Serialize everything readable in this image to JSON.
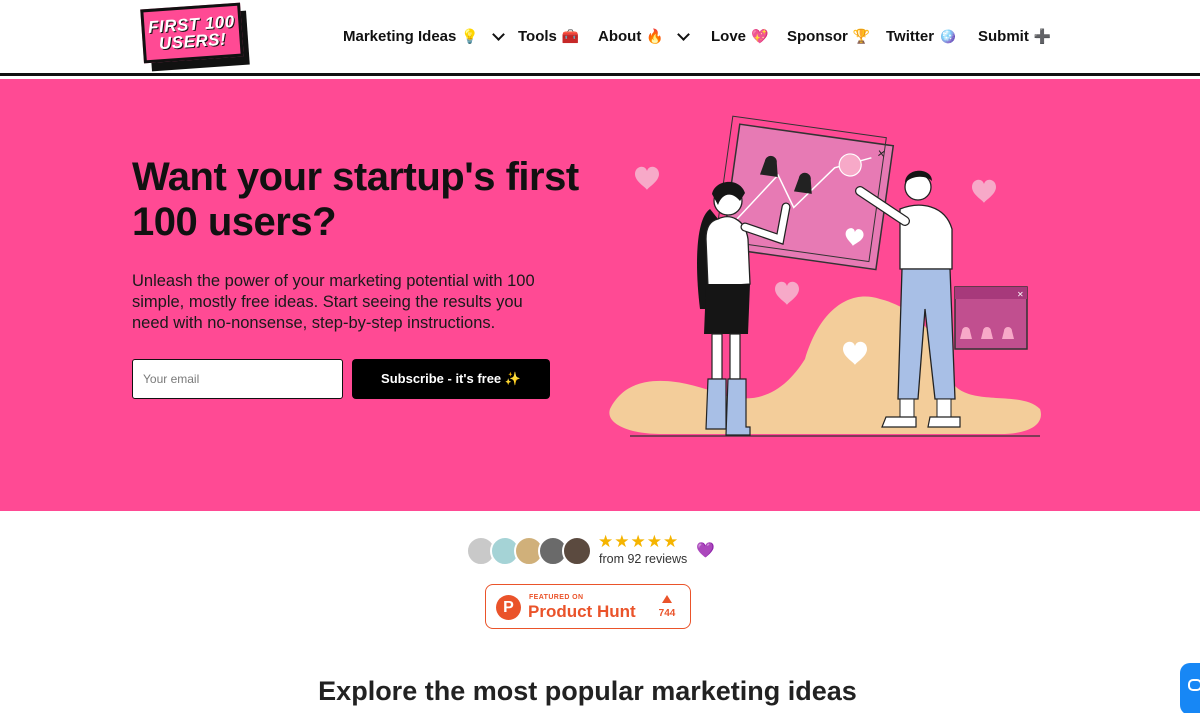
{
  "header": {
    "logo_line1": "FIRST 100",
    "logo_line2": "USERS!",
    "nav": [
      {
        "label": "Marketing Ideas",
        "emoji": "💡",
        "dropdown": true
      },
      {
        "label": "Tools",
        "emoji": "🧰",
        "dropdown": false
      },
      {
        "label": "About",
        "emoji": "🔥",
        "dropdown": true
      },
      {
        "label": "Love",
        "emoji": "💖",
        "dropdown": false
      },
      {
        "label": "Sponsor",
        "emoji": "🏆",
        "dropdown": false
      },
      {
        "label": "Twitter",
        "emoji": "🪩",
        "dropdown": false
      },
      {
        "label": "Submit",
        "emoji": "➕",
        "dropdown": false
      }
    ]
  },
  "hero": {
    "title": "Want your startup's first 100 users?",
    "subtitle": "Unleash the power of your marketing potential with 100 simple, mostly free ideas. Start seeing the results you need with no-nonsense, step-by-step instructions.",
    "email_placeholder": "Your email",
    "subscribe_label": "Subscribe - it's free ✨"
  },
  "reviews": {
    "stars": "★★★★★",
    "rating": 5,
    "text": "from 92 reviews",
    "heart": "💜"
  },
  "product_hunt": {
    "featured": "FEATURED ON",
    "name": "Product Hunt",
    "letter": "P",
    "count": "744"
  },
  "section": {
    "heading": "Explore the most popular marketing ideas"
  },
  "colors": {
    "brand_pink": "#ff4a94",
    "product_hunt": "#ea532a",
    "star": "#f5b400",
    "chat": "#1787f5"
  }
}
